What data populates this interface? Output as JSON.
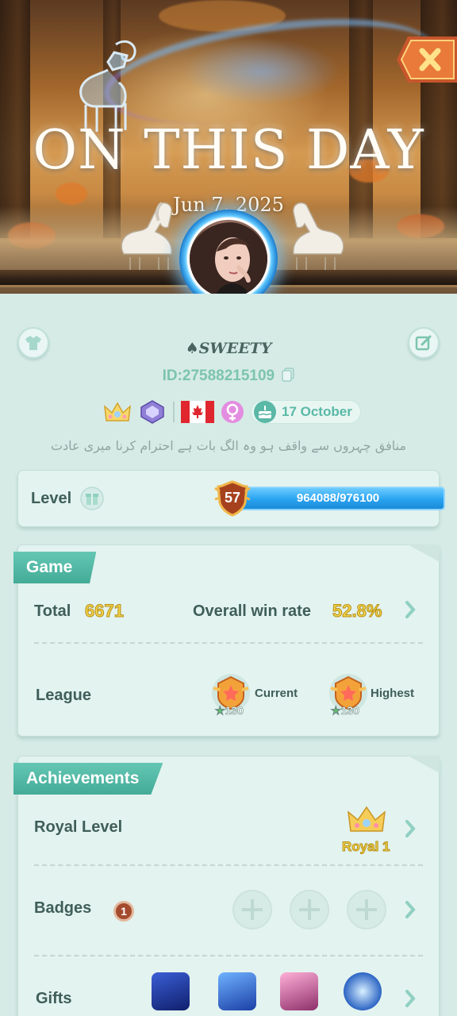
{
  "hero": {
    "title": "ON THIS DAY",
    "date": "Jun 7, 2025"
  },
  "profile": {
    "username": "SWEETY",
    "user_id": "ID:27588215109",
    "birthday": "17 October",
    "bio": "منافق چہروں سے واقف ہو  وہ الگ بات ہے احترام کرنا میری عادت"
  },
  "level": {
    "label": "Level",
    "value": "57",
    "progress_text": "964088/976100",
    "progress_fraction": 0.9877
  },
  "game": {
    "tab": "Game",
    "total_label": "Total",
    "total_value": "6671",
    "winrate_label": "Overall win rate",
    "winrate_value": "52.8%",
    "league_label": "League",
    "current_label": "Current",
    "current_value": "130",
    "highest_label": "Highest",
    "highest_value": "130"
  },
  "achievements": {
    "tab": "Achievements",
    "royal_label": "Royal Level",
    "royal_value": "Royal 1",
    "badges_label": "Badges",
    "badges_count": "1",
    "gifts_label": "Gifts"
  },
  "colors": {
    "background": "#d6ebe6",
    "accent": "#43ab97",
    "progress": "#28a3f0",
    "stat_yellow": "#f2d54c"
  },
  "icons": [
    "close-icon",
    "shirt-icon",
    "edit-icon",
    "copy-icon",
    "crown-icon",
    "diamond-badge-icon",
    "canada-flag-icon",
    "female-icon",
    "cake-icon",
    "gift-icon",
    "chevron-right-icon",
    "plus-icon",
    "league-medal-icon",
    "star-icon"
  ]
}
